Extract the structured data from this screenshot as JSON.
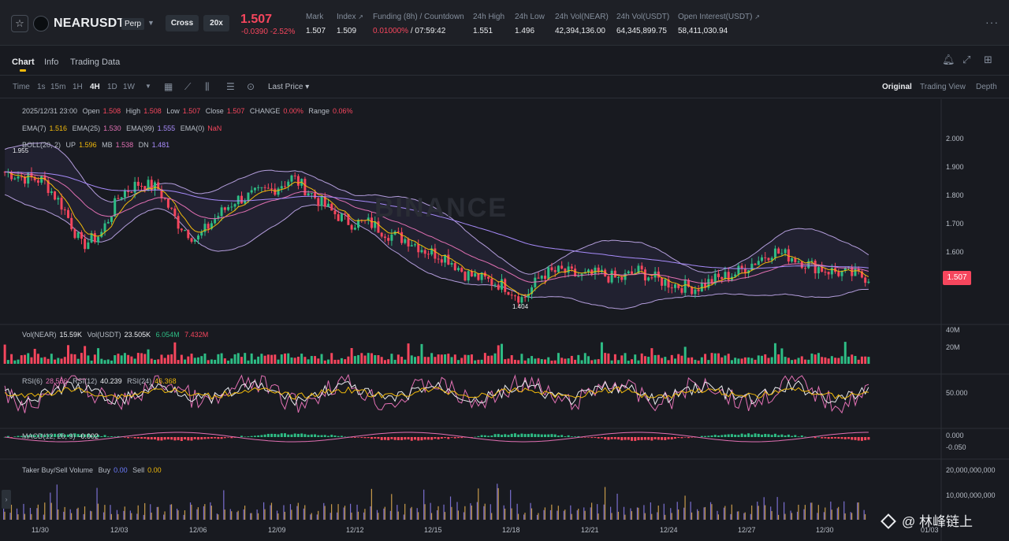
{
  "header": {
    "symbol": "NEARUSDT",
    "perp": "Perp",
    "margin_mode": "Cross",
    "leverage": "20x",
    "last_price": "1.507",
    "price_change": "-0.0390 -2.52%",
    "stats": [
      {
        "label": "Mark",
        "value": "1.507"
      },
      {
        "label": "Index",
        "value": "1.509"
      },
      {
        "label": "Funding (8h) / Countdown",
        "value_funding": "0.01000%",
        "value_countdown": " / 07:59:42"
      },
      {
        "label": "24h High",
        "value": "1.551"
      },
      {
        "label": "24h Low",
        "value": "1.496"
      },
      {
        "label": "24h Vol(NEAR)",
        "value": "42,394,136.00"
      },
      {
        "label": "24h Vol(USDT)",
        "value": "64,345,899.75"
      },
      {
        "label": "Open Interest(USDT)",
        "value": "58,411,030.94"
      }
    ]
  },
  "tabs": [
    {
      "label": "Chart"
    },
    {
      "label": "Info"
    },
    {
      "label": "Trading Data"
    }
  ],
  "toolbar": {
    "intervals": [
      "Time",
      "1s",
      "15m",
      "1H",
      "4H",
      "1D",
      "1W"
    ],
    "active_interval": "4H",
    "price_type": "Last Price",
    "views": [
      "Original",
      "Trading View",
      "Depth"
    ],
    "active_view": "Original"
  },
  "legend": {
    "ohlc": {
      "date": "2025/12/31 23:00",
      "open_label": "Open",
      "open": "1.508",
      "high_label": "High",
      "high": "1.508",
      "low_label": "Low",
      "low": "1.507",
      "close_label": "Close",
      "close": "1.507",
      "change_label": "CHANGE",
      "change": "0.00%",
      "range_label": "Range",
      "range": "0.06%"
    },
    "ema": {
      "ema7_label": "EMA(7)",
      "ema7": "1.516",
      "ema25_label": "EMA(25)",
      "ema25": "1.530",
      "ema99_label": "EMA(99)",
      "ema99": "1.555",
      "ema0_label": "EMA(0)",
      "ema0": "NaN"
    },
    "boll": {
      "label": "BOLL(20, 2)",
      "up_label": "UP",
      "up": "1.596",
      "mb_label": "MB",
      "mb": "1.538",
      "dn_label": "DN",
      "dn": "1.481"
    },
    "vol": {
      "near_label": "Vol(NEAR)",
      "near": "15.59K",
      "usdt_label": "Vol(USDT)",
      "usdt": "23.505K",
      "ma1": "6.054M",
      "ma2": "7.432M"
    },
    "rsi": {
      "rsi6_label": "RSI(6)",
      "rsi6": "28.566",
      "rsi12_label": "RSI(12)",
      "rsi12": "40.239",
      "rsi24_label": "RSI(24)",
      "rsi24": "46.368"
    },
    "macd": {
      "label": "MACD(12, 26, 9)",
      "value": "-0.002"
    },
    "taker": {
      "label": "Taker Buy/Sell Volume",
      "buy_label": "Buy",
      "buy": "0.00",
      "sell_label": "Sell",
      "sell": "0.00"
    }
  },
  "price_axis": [
    "2.000",
    "1.900",
    "1.800",
    "1.700",
    "1.600"
  ],
  "current_price_tag": "1.507",
  "high_marker": "1.955",
  "low_marker": "1.404",
  "vol_axis": [
    "40M",
    "20M"
  ],
  "rsi_axis": [
    "50.000"
  ],
  "macd_axis": [
    "0.000",
    "-0.050"
  ],
  "taker_axis": [
    "20,000,000,000",
    "10,000,000,000"
  ],
  "x_axis": [
    "11/30",
    "12/03",
    "12/06",
    "12/09",
    "12/12",
    "12/15",
    "12/18",
    "12/21",
    "12/24",
    "12/27",
    "12/30",
    "01/03"
  ],
  "watermark": "BINANCE",
  "overlay_watermark": "@ 林峰链上",
  "colors": {
    "up": "#2ebd85",
    "down": "#f6465d",
    "accent": "#f0b90b",
    "bg": "#181a20"
  },
  "chart_data": {
    "type": "candlestick",
    "interval": "4H",
    "x": [
      "11/30",
      "12/03",
      "12/06",
      "12/09",
      "12/12",
      "12/15",
      "12/18",
      "12/21",
      "12/24",
      "12/27",
      "12/30",
      "01/03"
    ],
    "close_path": [
      1.88,
      1.86,
      1.85,
      1.76,
      1.62,
      1.66,
      1.8,
      1.84,
      1.82,
      1.7,
      1.64,
      1.72,
      1.78,
      1.8,
      1.82,
      1.86,
      1.8,
      1.74,
      1.7,
      1.7,
      1.66,
      1.64,
      1.6,
      1.58,
      1.52,
      1.5,
      1.48,
      1.43,
      1.52,
      1.53,
      1.51,
      1.52,
      1.5,
      1.53,
      1.5,
      1.48,
      1.47,
      1.5,
      1.52,
      1.56,
      1.6,
      1.58,
      1.55,
      1.53,
      1.52,
      1.507
    ],
    "ylim": [
      1.35,
      2.05
    ]
  }
}
